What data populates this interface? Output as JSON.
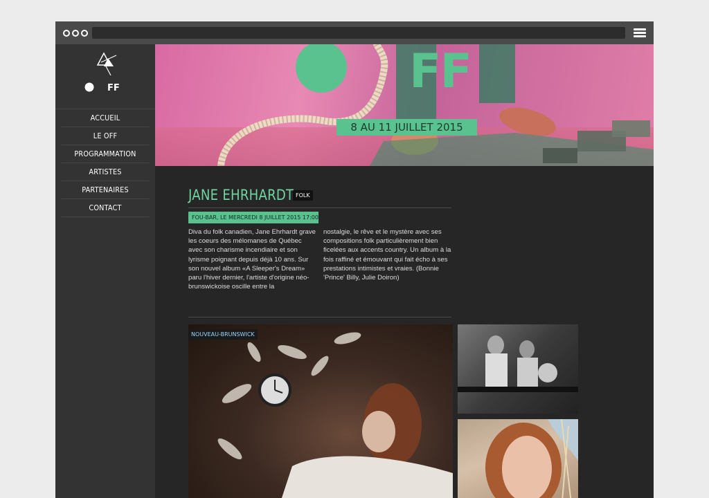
{
  "brand": {
    "logo_text": "FF",
    "hero_text": "FF",
    "accent": "#59c28e"
  },
  "nav": {
    "items": [
      "ACCUEIL",
      "LE OFF",
      "PROGRAMMATION",
      "ARTISTES",
      "PARTENAIRES",
      "CONTACT"
    ]
  },
  "hero": {
    "dates": "8 AU 11 JUILLET 2015"
  },
  "artist": {
    "name": "JANE EHRHARDT",
    "genre": "FOLK",
    "venue": "FOU-BAR, LE MERCREDI 8 JUILLET 2015 17:00",
    "description_col1": "Diva du folk canadien, Jane Ehrhardt grave les coeurs des mélomanes de Québec avec son charisme incendiaire et son lyrisme poignant depuis déjà 10 ans. Sur son nouvel album «A Sleeper's Dream» paru l'hiver dernier, l'artiste d'origine néo-brunswickoise oscille entre la",
    "description_col2": "nostalgie, le rêve et le mystère avec ses compositions folk particulièrement bien ficelées aux accents country. Un album à la fois raffiné et émouvant qui fait écho à ses prestations intimistes et vraies. (Bonnie 'Prince' Billy, Julie Doiron)",
    "region": "NOUVEAU-BRUNSWICK"
  }
}
